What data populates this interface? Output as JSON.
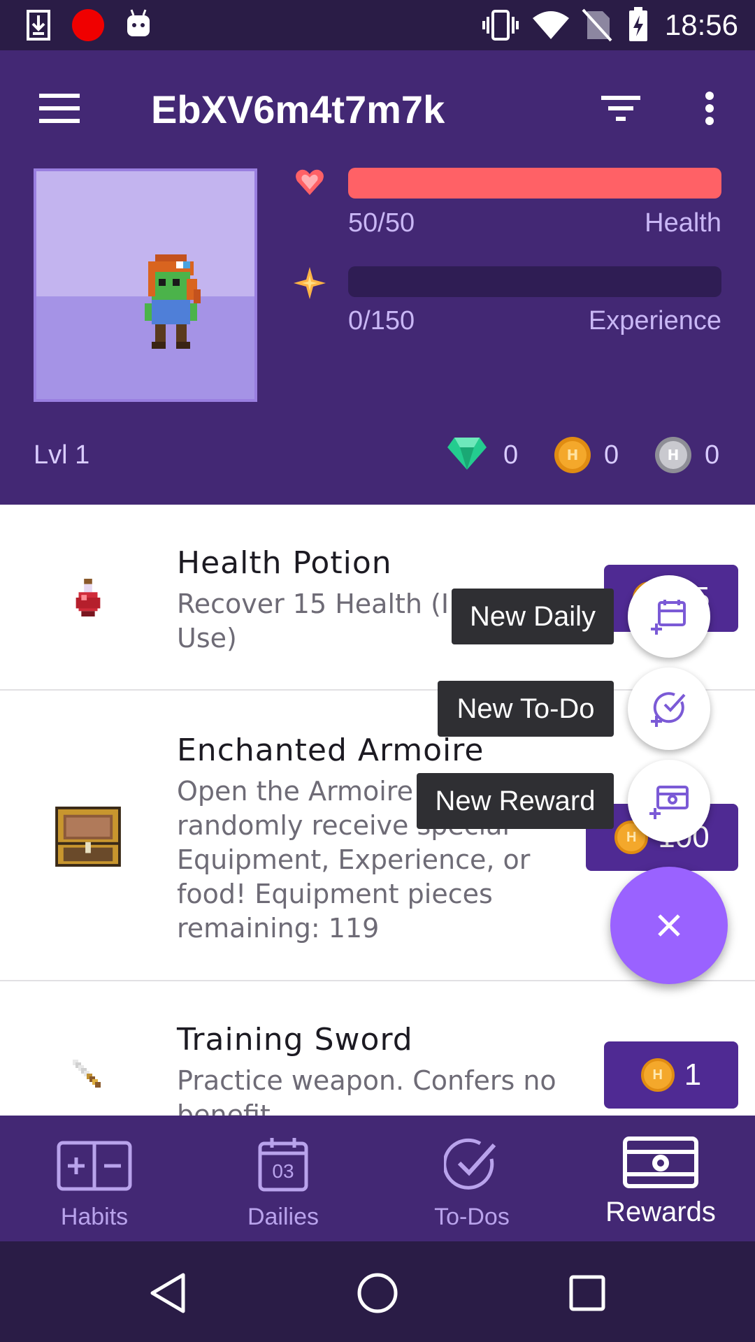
{
  "status_bar": {
    "time": "18:56",
    "icons": [
      "download-icon",
      "record-icon",
      "android-icon",
      "vibrate-icon",
      "wifi-icon",
      "no-sim-icon",
      "battery-charging-icon"
    ]
  },
  "toolbar": {
    "title": "EbXV6m4t7m7k",
    "icons": [
      "menu-icon",
      "filter-icon",
      "more-vert-icon"
    ]
  },
  "stats": {
    "health": {
      "value_text": "50/50",
      "label": "Health",
      "fill": 1.0,
      "color": "#ff6166"
    },
    "experience": {
      "value_text": "0/150",
      "label": "Experience",
      "fill": 0.0,
      "color": "#ffb445"
    },
    "level": "Lvl 1",
    "gems": "0",
    "gold": "0",
    "hourglasses": "0"
  },
  "rewards": [
    {
      "title": "Health Potion",
      "desc": "Recover 15 Health (I…\nUse)",
      "price": "25",
      "icon": "health-potion-icon"
    },
    {
      "title": "Enchanted Armoire",
      "desc": "Open the Armoire to randomly receive special Equipment, Experience, or food! Equipment pieces remaining: 119",
      "price": "100",
      "icon": "armoire-icon"
    },
    {
      "title": "Training Sword",
      "desc": "Practice weapon. Confers no benefit.",
      "price": "1",
      "icon": "sword-icon"
    }
  ],
  "fab_menu": {
    "new_daily": "New Daily",
    "new_todo": "New To-Do",
    "new_reward": "New Reward",
    "close_icon": "close-icon"
  },
  "bottom_nav": {
    "habits": "Habits",
    "dailies": "Dailies",
    "dailies_day": "03",
    "todos": "To-Dos",
    "rewards": "Rewards",
    "active": "rewards"
  },
  "colors": {
    "header": "#432874",
    "status_bar": "#2a1c46",
    "accent": "#9a62ff",
    "price_button": "#4f2a93"
  }
}
